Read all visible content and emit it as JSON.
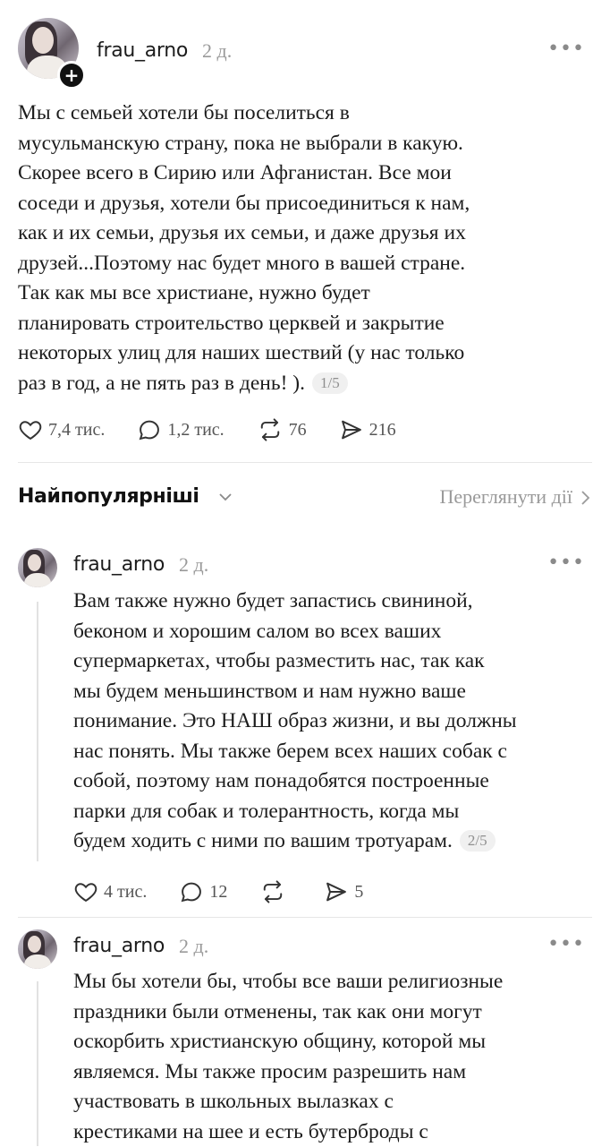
{
  "post": {
    "username": "frau_arno",
    "time": "2 д.",
    "lines": [
      "Мы с семьей хотели бы поселиться в",
      "мусульманскую страну, пока не выбрали в какую.",
      "Скорее всего в Сирию или Афганистан.  Все мои",
      "соседи и друзья, хотели бы присоединиться к нам,",
      "как и их семьи, друзья их семьи, и даже друзья их",
      "друзей...Поэтому нас будет много в вашей стране.",
      "Так как мы все христиане, нужно будет",
      "планировать строительство церквей и закрытие",
      "некоторых улиц для наших шествий (у нас только",
      "раз в год, а не пять раз в день! )."
    ],
    "pager": "1/5",
    "likes": "7,4 тис.",
    "comments": "1,2 тис.",
    "reposts": "76",
    "shares": "216"
  },
  "sort": {
    "label": "Найпопулярніші",
    "view_activity": "Переглянути дії"
  },
  "reply1": {
    "username": "frau_arno",
    "time": "2 д.",
    "lines": [
      "Вам также нужно будет запастись свининой,",
      "беконом и хорошим салом во всех ваших",
      "супермаркетах, чтобы разместить нас, так как",
      "мы будем меньшинством и нам нужно ваше",
      "понимание. Это НАШ образ жизни, и вы должны",
      "нас понять. Мы также берем всех наших собак с",
      "собой, поэтому нам понадобятся построенные",
      "парки для собак и толерантность, когда мы",
      "будем ходить с ними по вашим тротуарам."
    ],
    "pager": "2/5",
    "likes": "4 тис.",
    "comments": "12",
    "reposts": "",
    "shares": "5"
  },
  "reply2": {
    "username": "frau_arno",
    "time": "2 д.",
    "lines": [
      "Мы бы хотели бы, чтобы все ваши религиозные",
      "праздники были отменены, так как они могут",
      "оскорбить христианскую общину, которой мы",
      "являемся. Мы также просим разрешить нам",
      "участвовать в школьных вылазках с",
      "крестиками на шее и есть бутерброды с"
    ]
  },
  "icons": {
    "more": "more-horizontal-icon",
    "like": "heart-icon",
    "comment": "comment-bubble-icon",
    "repost": "repost-arrows-icon",
    "share": "send-icon",
    "follow": "plus-icon"
  }
}
